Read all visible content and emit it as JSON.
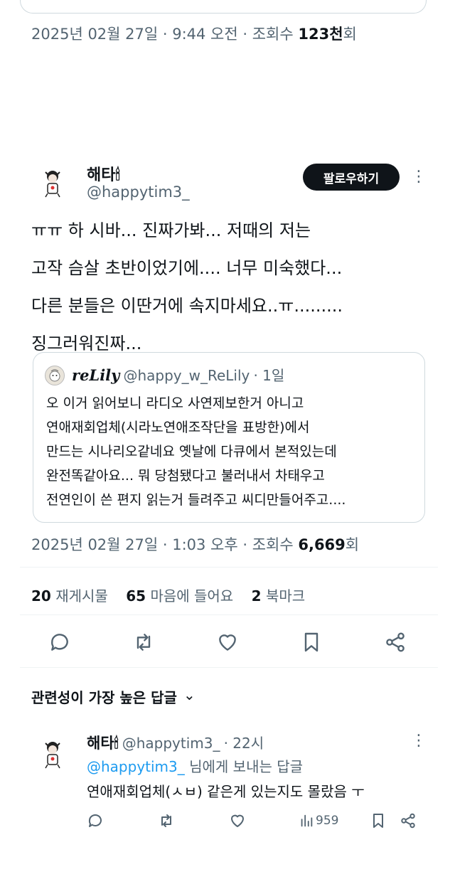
{
  "top_tweet": {
    "meta_date": "2025년 02월 27일 · 9:44 오전 · 조회수 ",
    "meta_views": "123천",
    "meta_suffix": "회"
  },
  "main_tweet": {
    "author_name": "해타🕯",
    "author_handle": "@happytim3_",
    "follow_label": "팔로우하기",
    "more_glyph": "⋮",
    "text_lines": [
      "ㅠㅠ 하 시바... 진짜가봐... 저때의 저는",
      "고작 슴살 초반이었기에.... 너무 미숙했다...",
      "다른 분들은 이딴거에 속지마세요..ㅠ.........",
      "징그러워진짜..."
    ],
    "quote": {
      "name": "reLily",
      "handle": "@happy_w_ReLily",
      "time": "· 1일",
      "lines": [
        "오 이거 읽어보니 라디오 사연제보한거 아니고",
        "연애재회업체(시라노연애조작단을 표방한)에서",
        "만드는 시나리오같네요 옛날에 다큐에서 본적있는데",
        "완전똑같아요... 뭐 당첨됐다고 불러내서 차태우고",
        "전연인이 쓴 편지 읽는거 들려주고 씨디만들어주고...."
      ]
    },
    "meta_date": "2025년 02월 27일 · 1:03 오후 · 조회수 ",
    "meta_views": "6,669",
    "meta_suffix": "회",
    "stats": {
      "reposts_count": "20",
      "reposts_label": "재게시물",
      "likes_count": "65",
      "likes_label": "마음에 들어요",
      "bookmarks_count": "2",
      "bookmarks_label": "북마크"
    }
  },
  "replies_section": {
    "title": "관련성이 가장 높은 답글",
    "chevron": "⌄"
  },
  "reply": {
    "author_name": "해타🕯",
    "author_handle": "@happytim3_",
    "time": "· 22시",
    "more_glyph": "⋮",
    "reply_to_handle": "@happytim3_",
    "reply_to_suffix": " 님에게 보내는 답글",
    "text": "연애재회업체(ㅅㅂ) 같은게 있는지도 몰랐음 ㅜ",
    "views": "959"
  },
  "colors": {
    "text": "#0f1419",
    "secondary": "#536471",
    "link": "#1d9bf0",
    "border": "#cfd9de"
  }
}
